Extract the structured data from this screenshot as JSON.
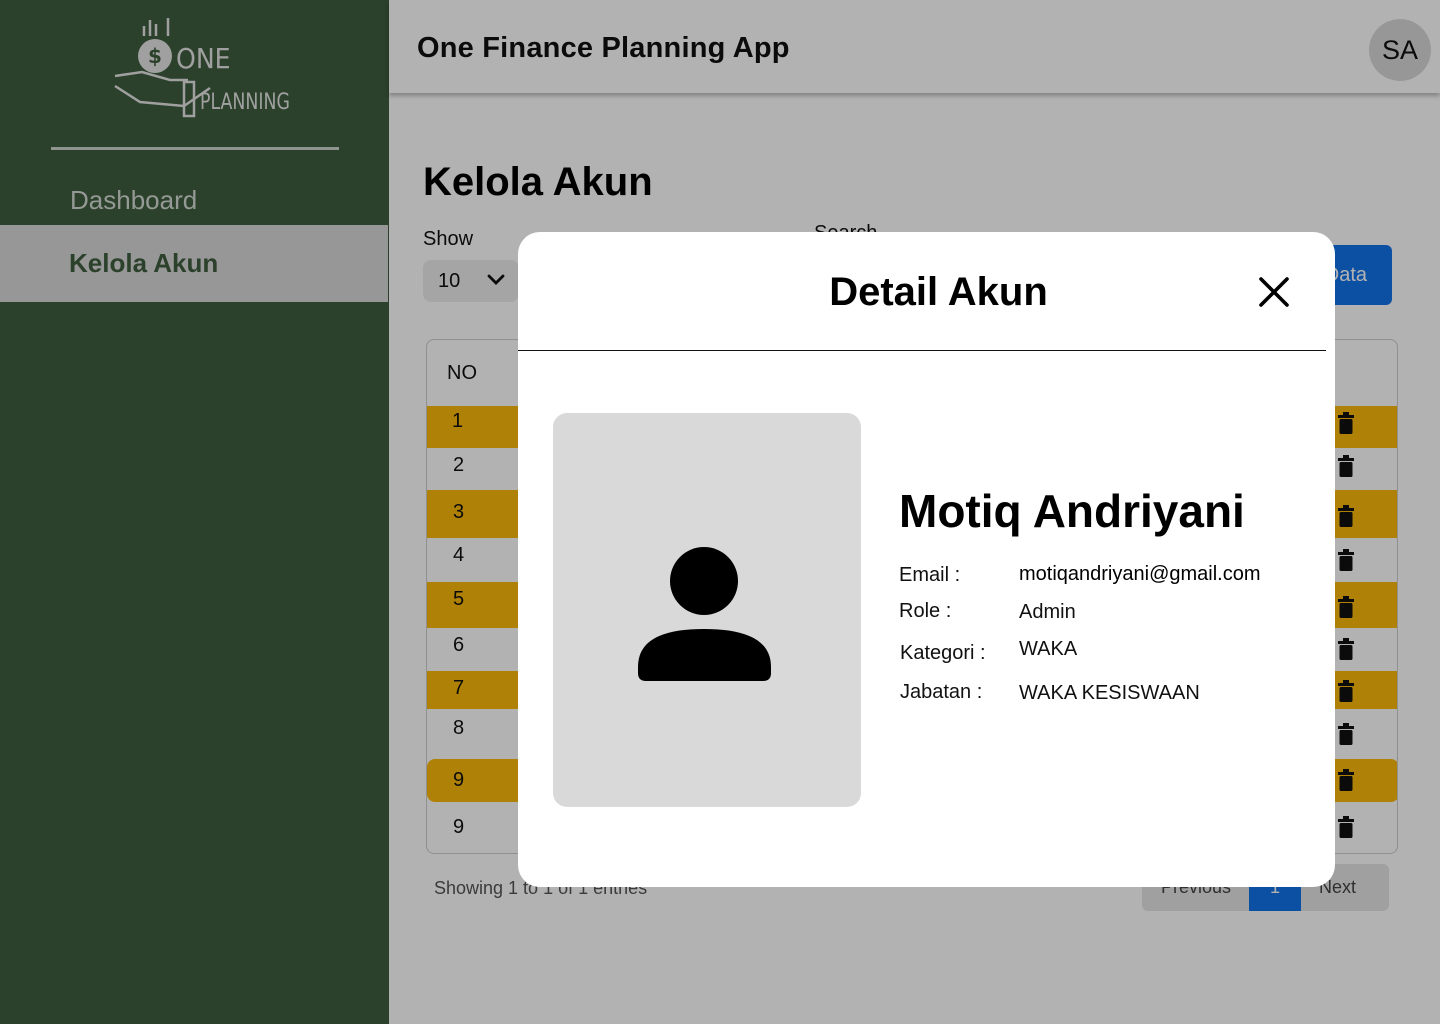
{
  "app": {
    "title": "One Finance Planning App",
    "avatar_initials": "SA",
    "logo": {
      "word_one": "ONE",
      "word_planning": "PLANNING"
    }
  },
  "sidebar": {
    "items": [
      {
        "label": "Dashboard",
        "active": false
      },
      {
        "label": "Kelola Akun",
        "active": true
      }
    ]
  },
  "main": {
    "page_title": "Kelola Akun",
    "show_label": "Show",
    "show_value": "10",
    "search_label": "Search",
    "add_button_label": "Data",
    "table": {
      "header_no": "NO",
      "rows": [
        "1",
        "2",
        "3",
        "4",
        "5",
        "6",
        "7",
        "8",
        "9",
        "9"
      ]
    },
    "showing_text": "Showing 1 to 1 of 1 entries",
    "pagination": {
      "previous": "Previous",
      "current_page": "1",
      "next": "Next"
    }
  },
  "modal": {
    "title": "Detail Akun",
    "name": "Motiq Andriyani",
    "fields": [
      {
        "label": "Email :",
        "value": "motiqandriyani@gmail.com"
      },
      {
        "label": "Role :",
        "value": "Admin"
      },
      {
        "label": "Kategori :",
        "value": "WAKA"
      },
      {
        "label": "Jabatan :",
        "value": "WAKA KESISWAAN"
      }
    ]
  },
  "colors": {
    "sidebar": "#3e5d3e",
    "row_highlight": "#fbb909",
    "primary_button": "#1273eb",
    "photo_placeholder": "#d9d9d9"
  },
  "icons": [
    "logo-icon",
    "chevron-down-icon",
    "trash-icon",
    "close-icon",
    "user-icon"
  ]
}
